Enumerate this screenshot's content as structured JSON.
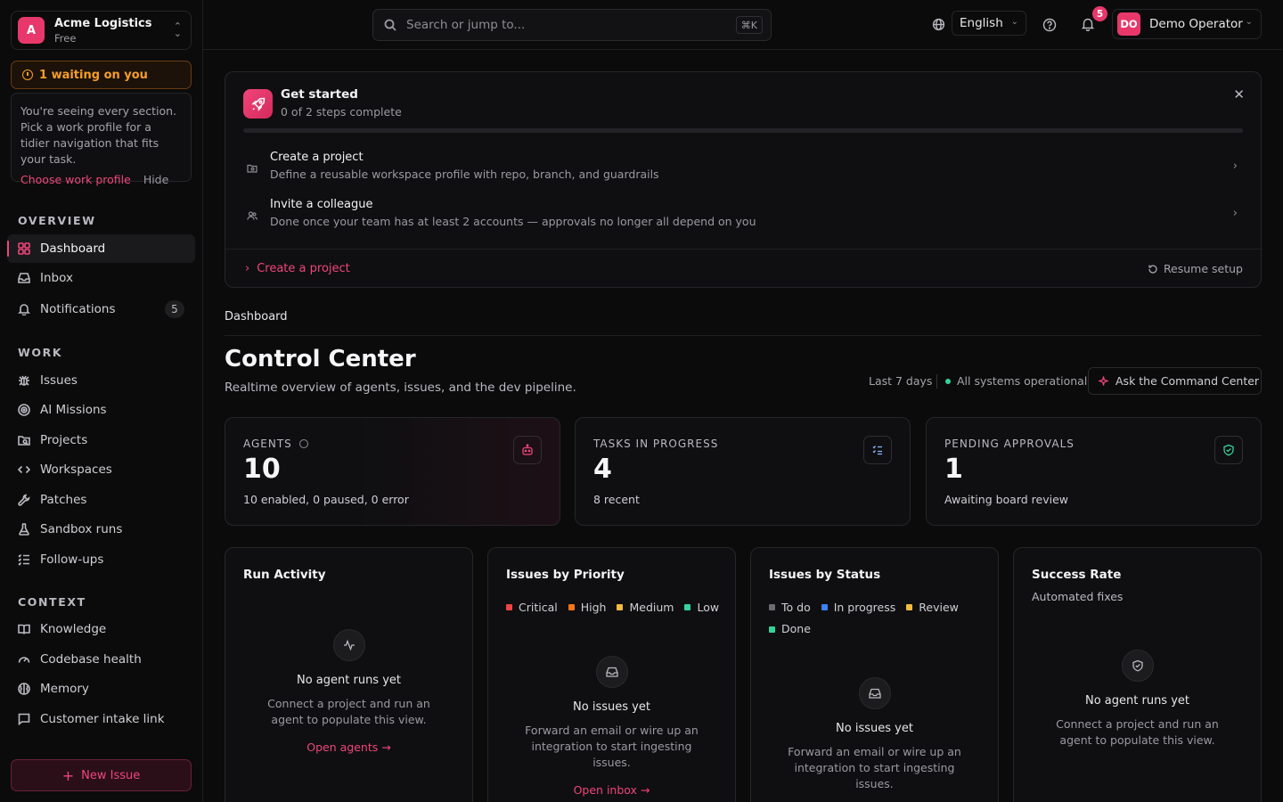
{
  "org": {
    "initial": "A",
    "name": "Acme Logistics",
    "plan": "Free"
  },
  "waiting": {
    "label": "1 waiting on you"
  },
  "profile_card": {
    "text": "You're seeing every section. Pick a work profile for a tidier navigation that fits your task.",
    "choose": "Choose work profile",
    "hide": "Hide"
  },
  "nav": {
    "overview_label": "OVERVIEW",
    "work_label": "WORK",
    "context_label": "CONTEXT",
    "dashboard": "Dashboard",
    "inbox": "Inbox",
    "notifications": "Notifications",
    "notifications_count": "5",
    "issues": "Issues",
    "ai_missions": "AI Missions",
    "projects": "Projects",
    "workspaces": "Workspaces",
    "patches": "Patches",
    "sandbox_runs": "Sandbox runs",
    "follow_ups": "Follow-ups",
    "knowledge": "Knowledge",
    "codebase_health": "Codebase health",
    "memory": "Memory",
    "customer_intake": "Customer intake link",
    "new_issue": "New Issue"
  },
  "topbar": {
    "search_placeholder": "Search or jump to...",
    "shortcut": "⌘K",
    "language": "English",
    "notif_count": "5",
    "user_initials": "DO",
    "user_name": "Demo Operator"
  },
  "get_started": {
    "title": "Get started",
    "progress_text": "0 of 2 steps complete",
    "progress": 0,
    "steps": [
      {
        "title": "Create a project",
        "desc": "Define a reusable workspace profile with repo, branch, and guardrails"
      },
      {
        "title": "Invite a colleague",
        "desc": "Done once your team has at least 2 accounts — approvals no longer all depend on you"
      }
    ],
    "cta": "Create a project",
    "resume": "Resume setup"
  },
  "page": {
    "breadcrumb": "Dashboard",
    "title": "Control Center",
    "subtitle": "Realtime overview of agents, issues, and the dev pipeline.",
    "range": "Last 7 days",
    "status": "All systems operational",
    "ask": "Ask the Command Center"
  },
  "stats": [
    {
      "label": "AGENTS",
      "value": "10",
      "note": "10 enabled, 0 paused, 0 error"
    },
    {
      "label": "TASKS IN PROGRESS",
      "value": "4",
      "note": "8 recent"
    },
    {
      "label": "PENDING APPROVALS",
      "value": "1",
      "note": "Awaiting board review"
    }
  ],
  "cards": {
    "run_activity": {
      "title": "Run Activity",
      "empty_title": "No agent runs yet",
      "empty_desc": "Connect a project and run an agent to populate this view.",
      "link": "Open agents →"
    },
    "priority": {
      "title": "Issues by Priority",
      "legend": [
        "Critical",
        "High",
        "Medium",
        "Low"
      ],
      "colors": [
        "#ef4444",
        "#f97316",
        "#f5b942",
        "#34d399"
      ],
      "empty_title": "No issues yet",
      "empty_desc": "Forward an email or wire up an integration to start ingesting issues.",
      "link": "Open inbox →"
    },
    "status": {
      "title": "Issues by Status",
      "legend": [
        "To do",
        "In progress",
        "Review",
        "Done"
      ],
      "colors": [
        "#6b6b72",
        "#3b82f6",
        "#f5b942",
        "#34d399"
      ],
      "empty_title": "No issues yet",
      "empty_desc": "Forward an email or wire up an integration to start ingesting issues."
    },
    "success": {
      "title": "Success Rate",
      "subtitle": "Automated fixes",
      "empty_title": "No agent runs yet",
      "empty_desc": "Connect a project and run an agent to populate this view."
    }
  },
  "colors": {
    "accent": "#f0457a",
    "warning": "#f59e2a",
    "ok": "#34d399"
  }
}
